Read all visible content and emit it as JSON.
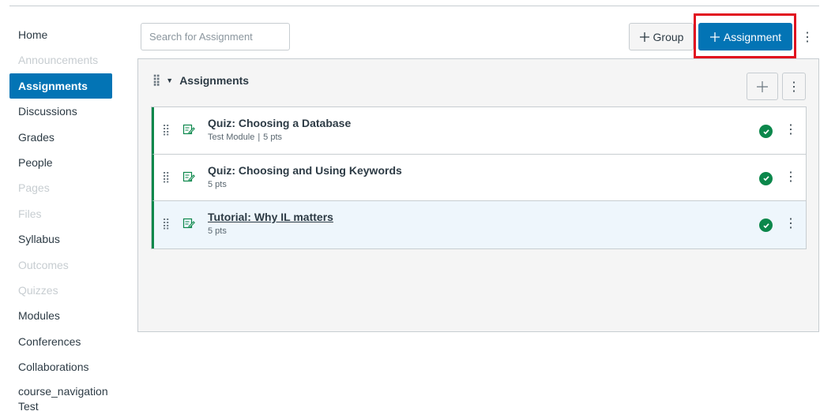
{
  "sidebar": {
    "items": [
      {
        "label": "Home",
        "state": "normal"
      },
      {
        "label": "Announcements",
        "state": "disabled"
      },
      {
        "label": "Assignments",
        "state": "active"
      },
      {
        "label": "Discussions",
        "state": "normal"
      },
      {
        "label": "Grades",
        "state": "normal"
      },
      {
        "label": "People",
        "state": "normal"
      },
      {
        "label": "Pages",
        "state": "disabled"
      },
      {
        "label": "Files",
        "state": "disabled"
      },
      {
        "label": "Syllabus",
        "state": "normal"
      },
      {
        "label": "Outcomes",
        "state": "disabled"
      },
      {
        "label": "Quizzes",
        "state": "disabled"
      },
      {
        "label": "Modules",
        "state": "normal"
      },
      {
        "label": "Conferences",
        "state": "normal"
      },
      {
        "label": "Collaborations",
        "state": "normal"
      },
      {
        "label": "course_navigation Test",
        "state": "normal"
      }
    ]
  },
  "toolbar": {
    "search_placeholder": "Search for Assignment",
    "group_button_label": "Group",
    "assignment_button_label": "Assignment",
    "kebab_glyph": "⋮"
  },
  "group": {
    "title": "Assignments",
    "kebab_glyph": "⋮",
    "rows": [
      {
        "title": "Quiz: Choosing a Database",
        "module": "Test Module",
        "separator": "|",
        "points": "5 pts",
        "hover": false
      },
      {
        "title": "Quiz: Choosing and Using Keywords",
        "module": "",
        "separator": "",
        "points": "5 pts",
        "hover": false
      },
      {
        "title": "Tutorial: Why IL matters",
        "module": "",
        "separator": "",
        "points": "5 pts",
        "hover": true
      }
    ]
  },
  "colors": {
    "brand_blue": "#0374b5",
    "published_green": "#0b874b",
    "highlight_red": "#e1101f"
  },
  "icons": {
    "plus": "plus-icon",
    "drag": "drag-handle-icon",
    "caret": "caret-down-icon",
    "quiz": "quiz-icon",
    "published": "published-check-icon",
    "kebab": "kebab-menu-icon"
  }
}
